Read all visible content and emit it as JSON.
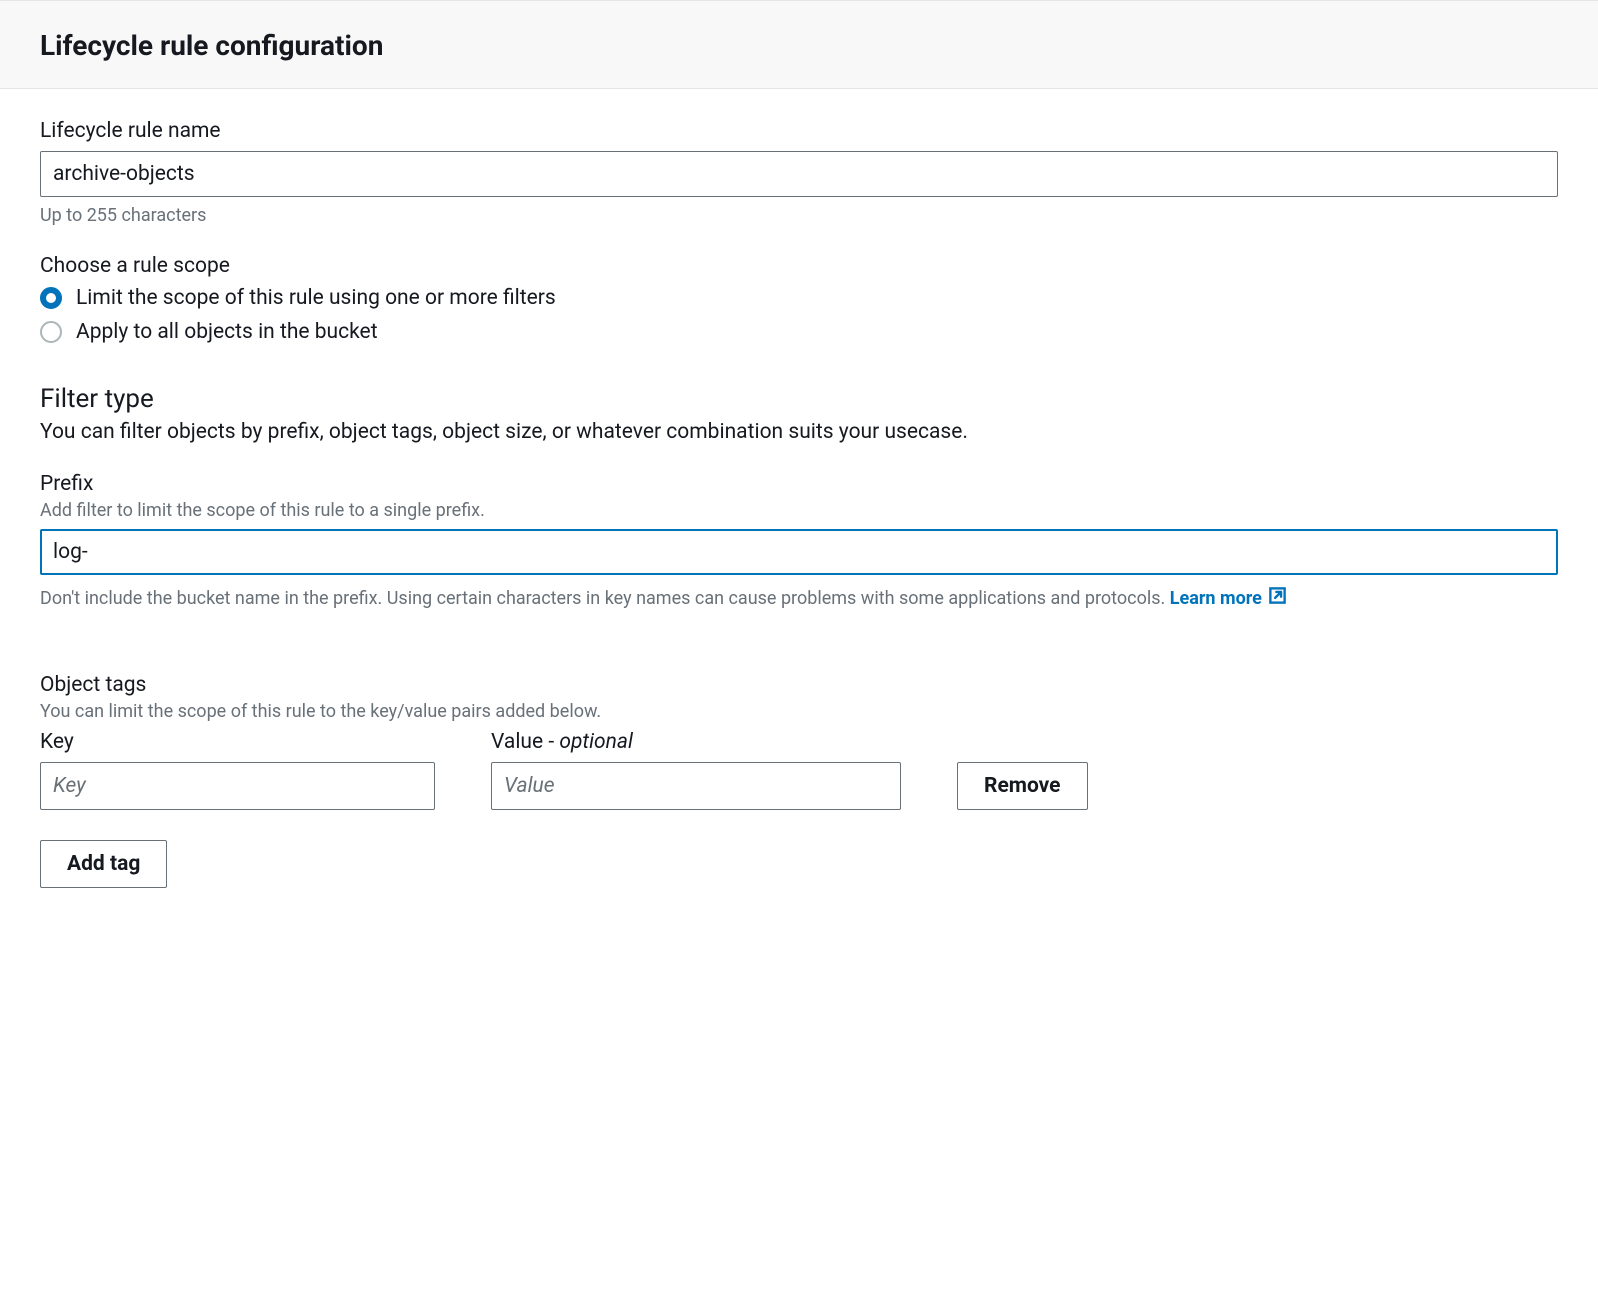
{
  "header": {
    "title": "Lifecycle rule configuration"
  },
  "ruleName": {
    "label": "Lifecycle rule name",
    "value": "archive-objects",
    "helper": "Up to 255 characters"
  },
  "ruleScope": {
    "label": "Choose a rule scope",
    "options": [
      {
        "label": "Limit the scope of this rule using one or more filters",
        "selected": true
      },
      {
        "label": "Apply to all objects in the bucket",
        "selected": false
      }
    ]
  },
  "filterType": {
    "title": "Filter type",
    "desc": "You can filter objects by prefix, object tags, object size, or whatever combination suits your usecase."
  },
  "prefix": {
    "label": "Prefix",
    "desc": "Add filter to limit the scope of this rule to a single prefix.",
    "value": "log-",
    "helper": "Don't include the bucket name in the prefix. Using certain characters in key names can cause problems with some applications and protocols. ",
    "learnMore": "Learn more"
  },
  "objectTags": {
    "label": "Object tags",
    "desc": "You can limit the scope of this rule to the key/value pairs added below.",
    "keyLabel": "Key",
    "valueLabel": "Value - ",
    "valueOptional": "optional",
    "keyPlaceholder": "Key",
    "valuePlaceholder": "Value",
    "removeLabel": "Remove",
    "addTagLabel": "Add tag",
    "rows": [
      {
        "key": "",
        "value": ""
      }
    ]
  }
}
